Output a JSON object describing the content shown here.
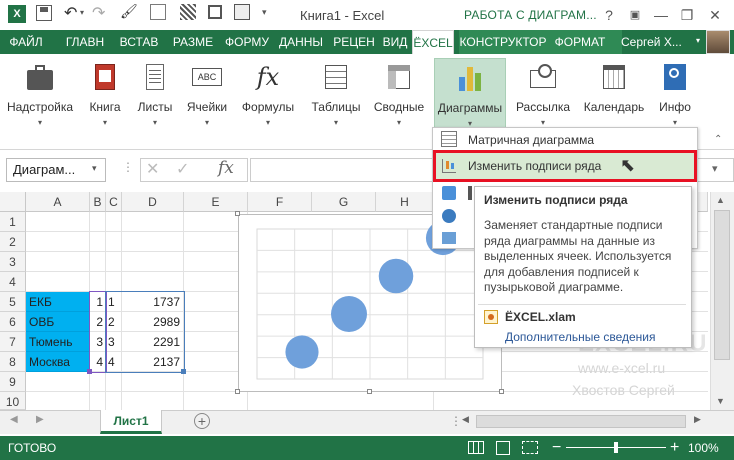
{
  "window": {
    "title": "Книга1 - Excel",
    "context_title": "РАБОТА С ДИАГРАМ...",
    "help": "?",
    "minimize": "—",
    "restore": "❐",
    "close": "✕"
  },
  "tabs": [
    "ФАЙЛ",
    "ГЛАВН",
    "ВСТАВ",
    "РАЗМЕ",
    "ФОРМУ",
    "ДАННЫ",
    "РЕЦЕН",
    "ВИД",
    "ЁXCEL",
    "КОНСТРУКТОР",
    "ФОРМАТ"
  ],
  "user": "Сергей Х...",
  "ribbon": [
    "Надстройка",
    "Книга",
    "Листы",
    "Ячейки",
    "Формулы",
    "Таблицы",
    "Сводные",
    "Диаграммы",
    "Рассылка",
    "Календарь",
    "Инфо"
  ],
  "namebox": "Диаграм...",
  "fx": "fx",
  "columns": [
    "A",
    "B",
    "C",
    "D",
    "E",
    "F",
    "G",
    "H"
  ],
  "rows": [
    "1",
    "2",
    "3",
    "4",
    "5",
    "6",
    "7",
    "8",
    "9",
    "10"
  ],
  "table": [
    {
      "name": "ЕКБ",
      "b": "1",
      "c": "1",
      "d": "1737"
    },
    {
      "name": "ОВБ",
      "b": "2",
      "c": "2",
      "d": "2989"
    },
    {
      "name": "Тюмень",
      "b": "3",
      "c": "3",
      "d": "2291"
    },
    {
      "name": "Москва",
      "b": "4",
      "c": "4",
      "d": "2137"
    }
  ],
  "menu": {
    "item1": "Матричная диаграмма",
    "item2": "Изменить подписи ряда"
  },
  "tooltip": {
    "title": "Изменить подписи ряда",
    "body": "Заменяет стандартные подписи ряда диаграммы на данные из выделенных ячеек. Используется для добавления подписей к пузырьковой диаграмме.",
    "addin": "ЁXCEL.xlam",
    "more": "Дополнительные сведения"
  },
  "watermark": {
    "url": "www.e-xcel.ru",
    "author": "Хвостов Сергей"
  },
  "sheet_tab": "Лист1",
  "status": {
    "ready": "ГОТОВО",
    "zoom": "100%"
  },
  "colors": {
    "excel_green": "#217346",
    "bubble": "#6fa0db",
    "selection": "#00b0f0",
    "highlight_red": "#e81123"
  }
}
